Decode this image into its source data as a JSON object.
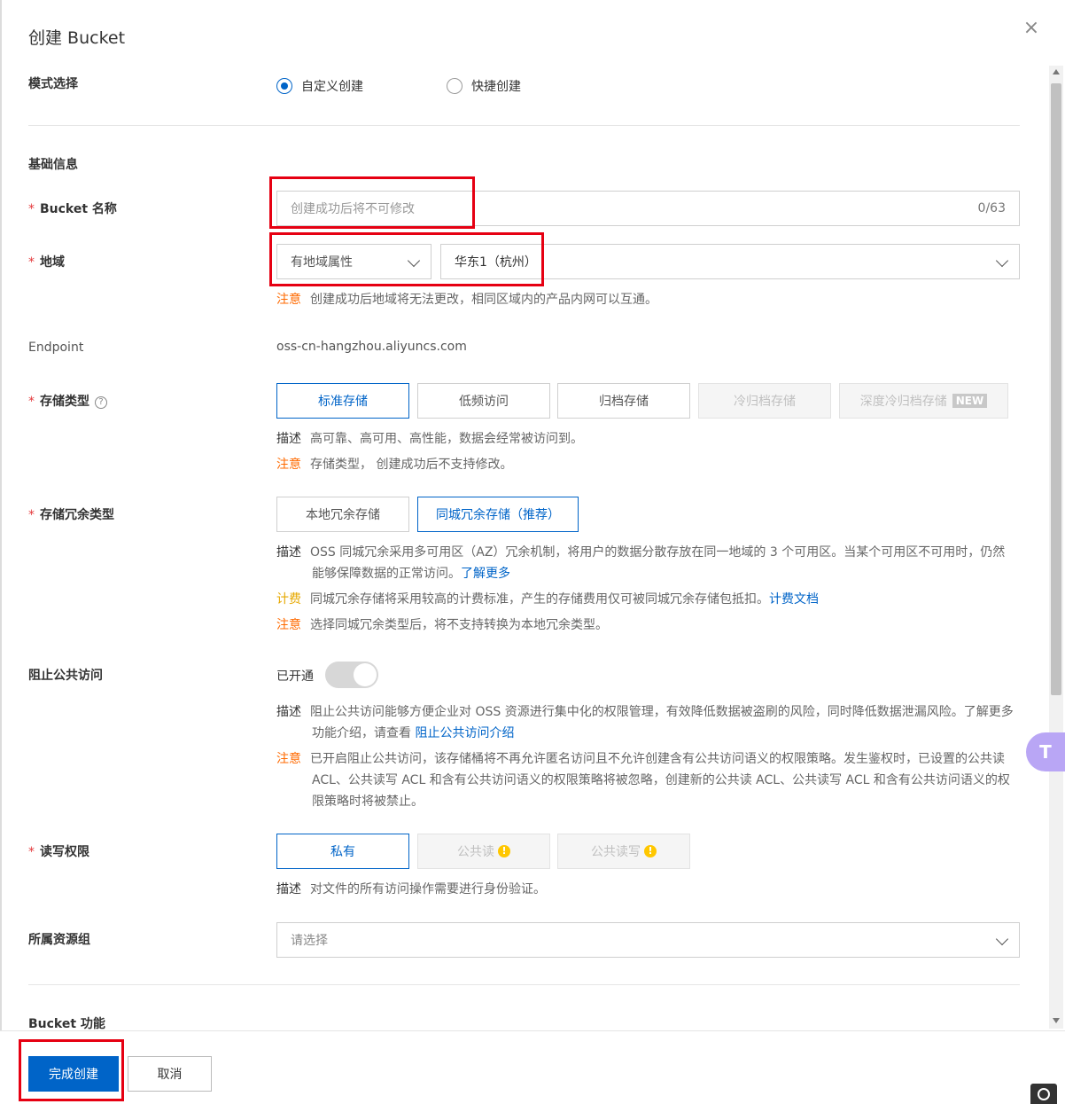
{
  "dialog": {
    "title": "创建 Bucket",
    "close_label": "×"
  },
  "mode": {
    "label": "模式选择",
    "options": [
      {
        "label": "自定义创建",
        "selected": true
      },
      {
        "label": "快捷创建",
        "selected": false
      }
    ]
  },
  "basic": {
    "section_title": "基础信息",
    "bucket_name": {
      "required": "*",
      "label": "Bucket 名称",
      "placeholder": "创建成功后将不可修改",
      "counter": "0/63"
    },
    "region": {
      "required": "*",
      "label": "地域",
      "attr_select": "有地域属性",
      "region_select": "华东1（杭州）",
      "note_tag": "注意",
      "note": "创建成功后地域将无法更改，相同区域内的产品内网可以互通。"
    },
    "endpoint": {
      "label": "Endpoint",
      "value": "oss-cn-hangzhou.aliyuncs.com"
    },
    "storage_class": {
      "required": "*",
      "label": "存储类型",
      "help_icon": "?",
      "options": [
        {
          "label": "标准存储",
          "state": "active"
        },
        {
          "label": "低频访问",
          "state": "normal"
        },
        {
          "label": "归档存储",
          "state": "normal"
        },
        {
          "label": "冷归档存储",
          "state": "disabled"
        },
        {
          "label": "深度冷归档存储",
          "state": "disabled",
          "badge": "NEW"
        }
      ],
      "desc_tag": "描述",
      "desc": "高可靠、高可用、高性能，数据会经常被访问到。",
      "note_tag": "注意",
      "note": "存储类型， 创建成功后不支持修改。"
    },
    "redundancy": {
      "required": "*",
      "label": "存储冗余类型",
      "options": [
        {
          "label": "本地冗余存储",
          "state": "normal"
        },
        {
          "label": "同城冗余存储（推荐）",
          "state": "active"
        }
      ],
      "desc_tag": "描述",
      "desc": "OSS 同城冗余采用多可用区（AZ）冗余机制，将用户的数据分散存放在同一地域的 3 个可用区。当某个可用区不可用时，仍然能够保障数据的正常访问。",
      "desc_link": "了解更多",
      "fee_tag": "计费",
      "fee": "同城冗余存储将采用较高的计费标准，产生的存储费用仅可被同城冗余存储包抵扣。",
      "fee_link": "计费文档",
      "note_tag": "注意",
      "note": "选择同城冗余类型后，将不支持转换为本地冗余类型。"
    },
    "block_public": {
      "label": "阻止公共访问",
      "status": "已开通",
      "toggle_on": true,
      "desc_tag": "描述",
      "desc": "阻止公共访问能够方便企业对 OSS 资源进行集中化的权限管理，有效降低数据被盗刷的风险，同时降低数据泄漏风险。了解更多功能介绍，请查看 ",
      "desc_link": "阻止公共访问介绍",
      "note_tag": "注意",
      "note": "已开启阻止公共访问，该存储桶将不再允许匿名访问且不允许创建含有公共访问语义的权限策略。发生鉴权时，已设置的公共读 ACL、公共读写 ACL 和含有公共访问语义的权限策略将被忽略，创建新的公共读 ACL、公共读写 ACL 和含有公共访问语义的权限策略时将被禁止。"
    },
    "acl": {
      "required": "*",
      "label": "读写权限",
      "options": [
        {
          "label": "私有",
          "state": "active"
        },
        {
          "label": "公共读",
          "state": "disabled",
          "warn": "!"
        },
        {
          "label": "公共读写",
          "state": "disabled",
          "warn": "!"
        }
      ],
      "desc_tag": "描述",
      "desc": "对文件的所有访问操作需要进行身份验证。"
    },
    "resource_group": {
      "label": "所属资源组",
      "placeholder": "请选择"
    }
  },
  "bucket_features": {
    "section_title": "Bucket 功能"
  },
  "footer": {
    "confirm": "完成创建",
    "cancel": "取消"
  },
  "colors": {
    "primary": "#0064c8",
    "highlight_box": "#e60012",
    "note": "#ff6a00",
    "fee": "#e6a800"
  }
}
